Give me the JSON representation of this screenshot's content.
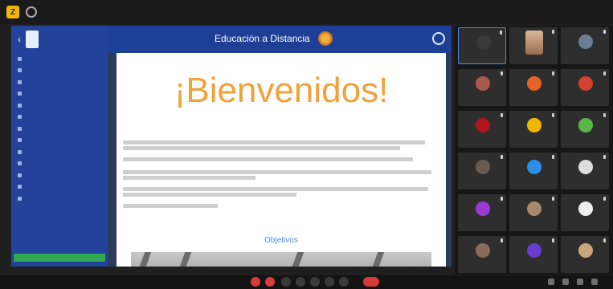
{
  "window": {
    "title": "",
    "app_logo_icon": "meeting-app-logo-icon"
  },
  "shared_screen": {
    "lms": {
      "header": {
        "course_title": "Educación a Distancia"
      },
      "sidebar": {
        "items": [
          {
            "label": "",
            "icon": "page-icon"
          },
          {
            "label": "",
            "icon": "page-icon"
          },
          {
            "label": "",
            "icon": "page-icon"
          },
          {
            "label": "",
            "icon": "page-icon"
          },
          {
            "label": "",
            "icon": "page-icon"
          },
          {
            "label": "",
            "icon": "page-icon"
          },
          {
            "label": "",
            "icon": "page-icon"
          },
          {
            "label": "",
            "icon": "page-icon"
          },
          {
            "label": "",
            "icon": "page-icon"
          },
          {
            "label": "",
            "icon": "page-icon"
          },
          {
            "label": "",
            "icon": "page-icon"
          },
          {
            "label": "",
            "icon": "page-icon"
          },
          {
            "label": "",
            "icon": "page-icon"
          }
        ]
      },
      "page": {
        "welcome": "¡Bienvenidos!",
        "objectives_heading": "Objetivos"
      }
    }
  },
  "participants": [
    {
      "name": "",
      "initial": "",
      "color": "#3a3a3a",
      "active": true
    },
    {
      "name": "",
      "initial": "",
      "color": "#8a6a4a",
      "active": false
    },
    {
      "name": "",
      "initial": "",
      "color": "#6a7f95",
      "active": false
    },
    {
      "name": "",
      "initial": "",
      "color": "#a65a4a",
      "active": false
    },
    {
      "name": "",
      "initial": "",
      "color": "#e8622c",
      "active": false
    },
    {
      "name": "",
      "initial": "",
      "color": "#d6402e",
      "active": false
    },
    {
      "name": "",
      "initial": "",
      "color": "#b0151b",
      "active": false
    },
    {
      "name": "",
      "initial": "",
      "color": "#f2b705",
      "active": false
    },
    {
      "name": "",
      "initial": "",
      "color": "#59b84a",
      "active": false
    },
    {
      "name": "",
      "initial": "",
      "color": "#6a5a50",
      "active": false
    },
    {
      "name": "",
      "initial": "",
      "color": "#2a8fe6",
      "active": false
    },
    {
      "name": "",
      "initial": "",
      "color": "#dcdcdc",
      "active": false
    },
    {
      "name": "",
      "initial": "",
      "color": "#9a3ad1",
      "active": false
    },
    {
      "name": "",
      "initial": "",
      "color": "#a88a6a",
      "active": false
    },
    {
      "name": "",
      "initial": "",
      "color": "#eeeeee",
      "active": false
    },
    {
      "name": "",
      "initial": "",
      "color": "#8a6a5a",
      "active": false
    },
    {
      "name": "",
      "initial": "",
      "color": "#6b3ad1",
      "active": false
    },
    {
      "name": "",
      "initial": "",
      "color": "#c7a77a",
      "active": false
    }
  ],
  "bottom_bar": {
    "status": ""
  },
  "colors": {
    "accent": "#4a8cf0",
    "lms_blue": "#23439b",
    "welcome_orange": "#f0a23c",
    "danger": "#d93a3a"
  }
}
